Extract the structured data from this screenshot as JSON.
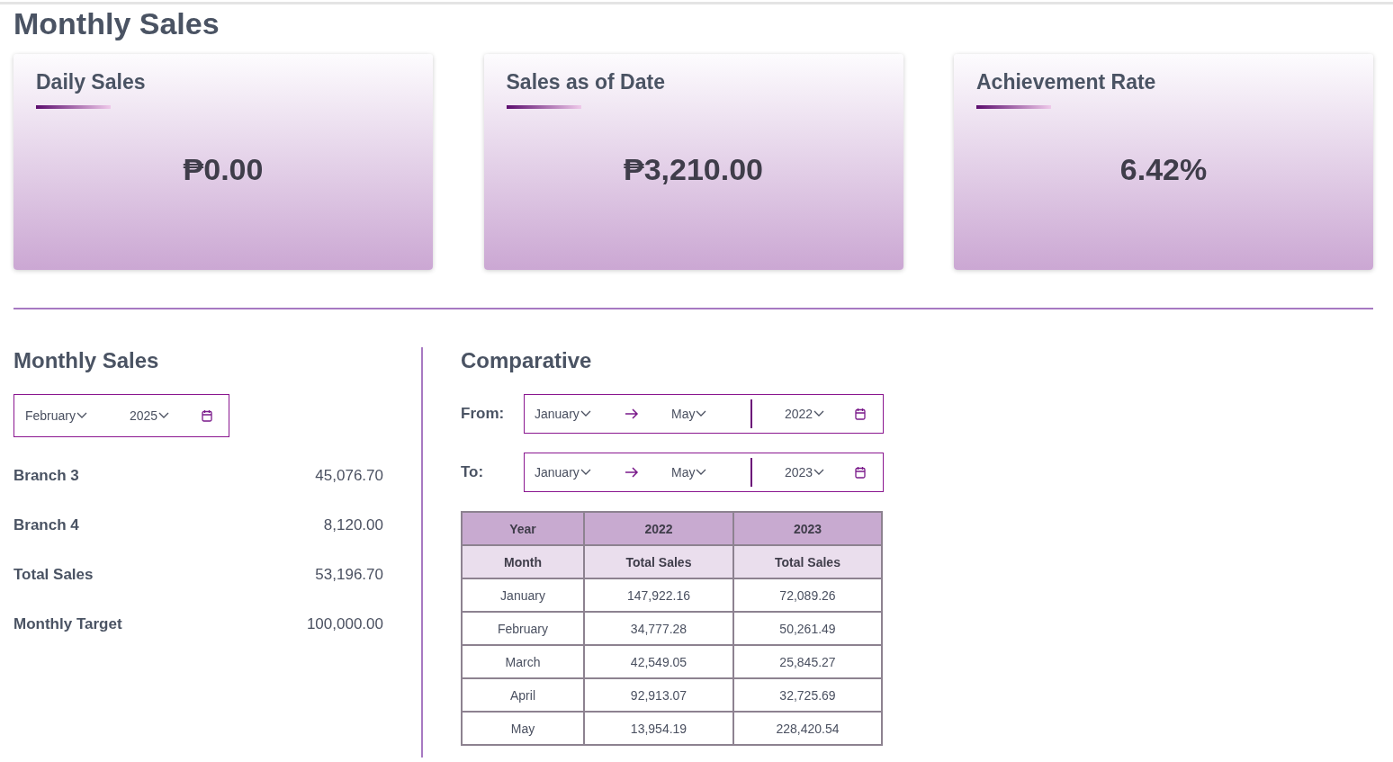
{
  "page_title": "Monthly Sales",
  "cards": [
    {
      "title": "Daily Sales",
      "value": "₱0.00"
    },
    {
      "title": "Sales as of Date",
      "value": "₱3,210.00"
    },
    {
      "title": "Achievement Rate",
      "value": "6.42%"
    }
  ],
  "monthly": {
    "title": "Monthly Sales",
    "month": "February",
    "year": "2025",
    "rows": [
      {
        "label": "Branch 3",
        "value": "45,076.70"
      },
      {
        "label": "Branch 4",
        "value": "8,120.00"
      },
      {
        "label": "Total Sales",
        "value": "53,196.70"
      },
      {
        "label": "Monthly Target",
        "value": "100,000.00"
      }
    ]
  },
  "comparative": {
    "title": "Comparative",
    "ranges": [
      {
        "label": "From:",
        "start_month": "January",
        "end_month": "May",
        "year": "2022"
      },
      {
        "label": "To:",
        "start_month": "January",
        "end_month": "May",
        "year": "2023"
      }
    ],
    "table": {
      "header_rows": [
        [
          "Year",
          "2022",
          "2023"
        ],
        [
          "Month",
          "Total Sales",
          "Total Sales"
        ]
      ],
      "rows": [
        [
          "January",
          "147,922.16",
          "72,089.26"
        ],
        [
          "February",
          "34,777.28",
          "50,261.49"
        ],
        [
          "March",
          "42,549.05",
          "25,845.27"
        ],
        [
          "April",
          "92,913.07",
          "32,725.69"
        ],
        [
          "May",
          "13,954.19",
          "228,420.54"
        ]
      ]
    }
  }
}
